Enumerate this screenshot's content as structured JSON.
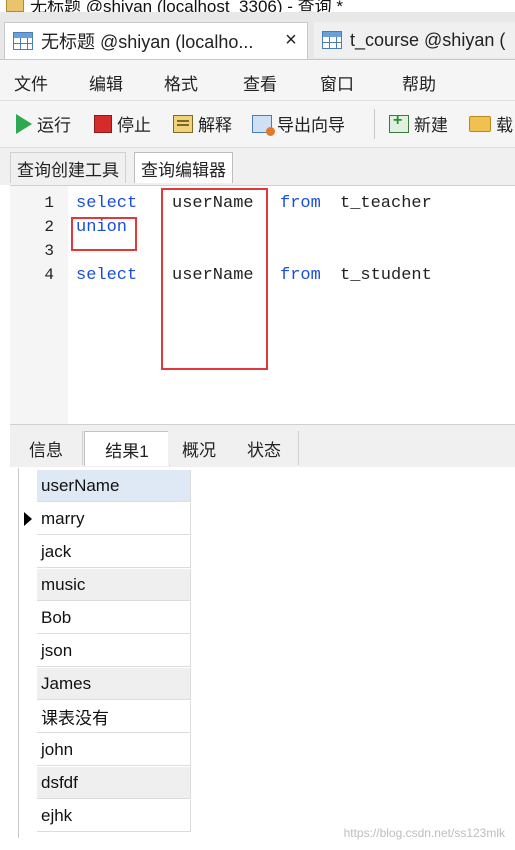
{
  "window": {
    "title": "无标题 @shiyan (localhost_3306) - 查询 *"
  },
  "doc_tabs": [
    {
      "label": "无标题 @shiyan (localho...",
      "close": "×"
    },
    {
      "label": "t_course @shiyan ("
    }
  ],
  "menu": [
    "文件",
    "编辑",
    "格式",
    "查看",
    "窗口",
    "帮助"
  ],
  "toolbar": {
    "run": "运行",
    "stop": "停止",
    "explain": "解释",
    "export": "导出向导",
    "new": "新建",
    "load": "载"
  },
  "sub_tabs": {
    "builder": "查询创建工具",
    "editor": "查询编辑器"
  },
  "editor": {
    "lines": [
      {
        "num": "1",
        "kw1": "select",
        "id1": "userName",
        "kw2": "from",
        "id2": "t_teacher"
      },
      {
        "num": "2",
        "kw1": "union"
      },
      {
        "num": "3"
      },
      {
        "num": "4",
        "kw1": "select",
        "id1": "userName",
        "kw2": "from",
        "id2": "t_student"
      }
    ]
  },
  "result_tabs": [
    "信息",
    "结果1",
    "概况",
    "状态"
  ],
  "results": {
    "column": "userName",
    "rows": [
      "marry",
      "jack",
      "music",
      "Bob",
      "json",
      "James",
      "课表没有",
      "john",
      "dsfdf",
      "ejhk"
    ]
  },
  "watermark": "https://blog.csdn.net/ss123mlk",
  "colors": {
    "keyword": "#1a4fd8",
    "highlight": "#e0383d",
    "header": "#dfe9f5"
  }
}
